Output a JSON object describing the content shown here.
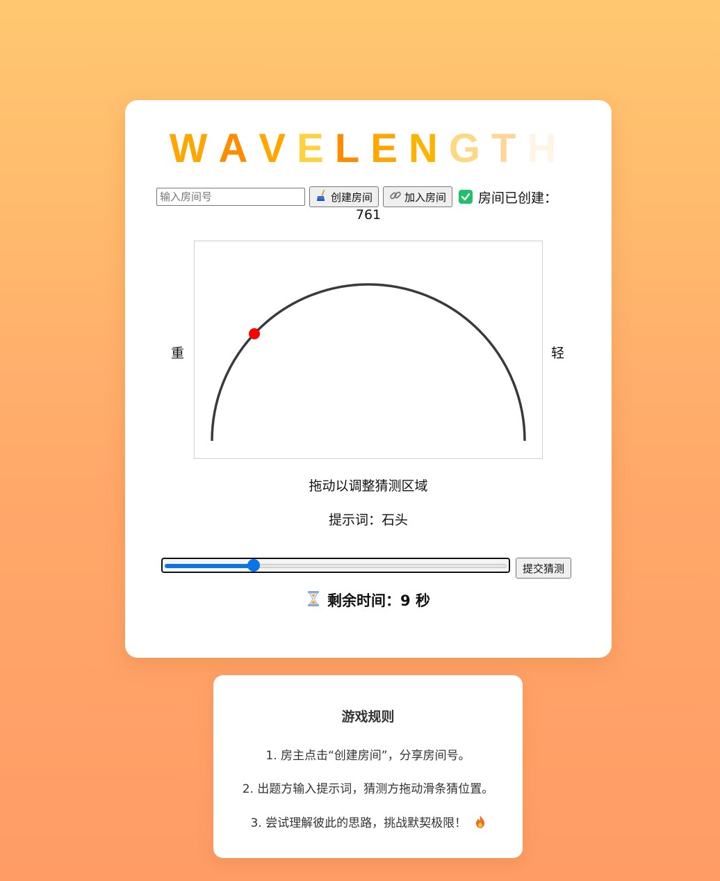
{
  "app": {
    "title_letters": [
      {
        "ch": "W",
        "color": "#ffa600"
      },
      {
        "ch": "A",
        "color": "#ff8c00"
      },
      {
        "ch": "V",
        "color": "#ffa600"
      },
      {
        "ch": "E",
        "color": "#ffd03f"
      },
      {
        "ch": "L",
        "color": "#ff8c00"
      },
      {
        "ch": "E",
        "color": "#ffa600"
      },
      {
        "ch": "N",
        "color": "#ffb300"
      },
      {
        "ch": "G",
        "color": "#ffd884"
      },
      {
        "ch": "T",
        "color": "#ffd69a"
      },
      {
        "ch": "H",
        "color": "#fff4e6"
      }
    ]
  },
  "room": {
    "input_placeholder": "输入房间号",
    "create_label": "创建房间",
    "join_label": "加入房间",
    "status_text": "房间已创建：",
    "room_number": "761"
  },
  "gauge": {
    "left_label": "重",
    "right_label": "轻",
    "marker_fraction": 0.24,
    "drag_hint": "拖动以调整猜测区域"
  },
  "clue": {
    "text": "提示词：石头"
  },
  "guess": {
    "slider_value_fraction": 0.26,
    "submit_label": "提交猜测"
  },
  "timer": {
    "text": "剩余时间：9 秒"
  },
  "rules": {
    "title": "游戏规则",
    "items": [
      "1. 房主点击“创建房间”，分享房间号。",
      "2. 出题方输入提示词，猜测方拖动滑条猜位置。",
      "3. 尝试理解彼此的思路，挑战默契极限！"
    ]
  },
  "colors": {
    "accent_blue": "#0a74e6",
    "marker_red": "#ff0000",
    "check_green": "#21c06b"
  }
}
